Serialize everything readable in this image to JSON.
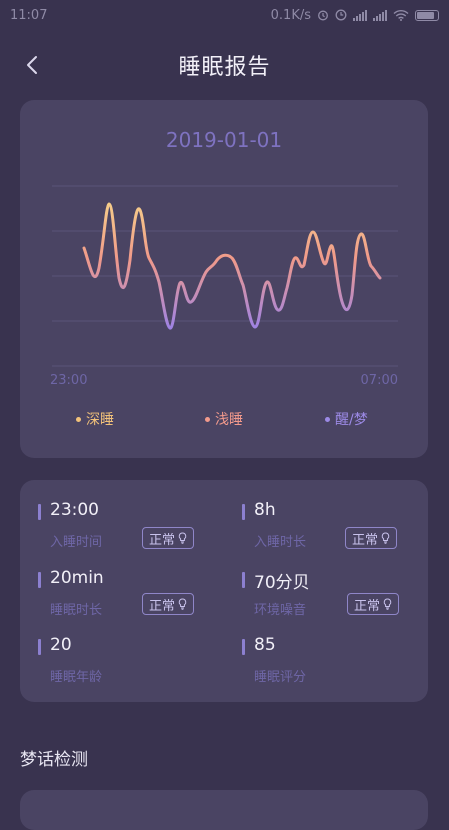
{
  "status_bar": {
    "time": "11:07",
    "speed": "0.1K/s"
  },
  "header": {
    "title": "睡眠报告"
  },
  "chart": {
    "date": "2019-01-01",
    "x_start_label": "23:00",
    "x_end_label": "07:00",
    "legend": [
      {
        "label": "深睡",
        "color": "#f2c27a"
      },
      {
        "label": "浅睡",
        "color": "#f29a8c"
      },
      {
        "label": "醒/梦",
        "color": "#9c8ae6"
      }
    ]
  },
  "info": {
    "bedtime": {
      "value": "23:00",
      "label": "入睡时间",
      "status": "正常"
    },
    "duration": {
      "value": "8h",
      "label": "入睡时长",
      "status": "正常"
    },
    "sleep_time": {
      "value": "20min",
      "label": "睡眠时长",
      "status": "正常"
    },
    "noise": {
      "value": "70分贝",
      "label": "环境噪音",
      "status": "正常"
    },
    "age": {
      "value": "20",
      "label": "睡眠年龄"
    },
    "score": {
      "value": "85",
      "label": "睡眠评分"
    }
  },
  "dream_section": {
    "title": "梦话检测"
  }
}
